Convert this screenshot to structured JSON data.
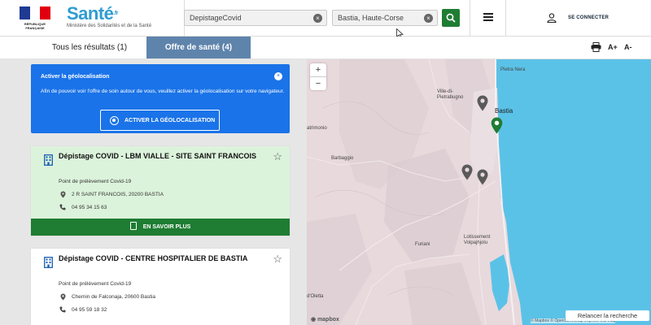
{
  "header": {
    "republic_text": "RÉPUBLIQUE FRANÇAISE",
    "brand_name": "Santé",
    "brand_suffix": ".fr",
    "brand_subtitle": "Ministère des Solidarités et de la Santé",
    "search_value": "DepistageCovid",
    "location_value": "Bastia, Haute-Corse",
    "connect_label": "SE CONNECTER"
  },
  "tabs": [
    {
      "label": "Tous les résultats (1)",
      "active": false
    },
    {
      "label": "Offre de santé (4)",
      "active": true
    }
  ],
  "toolbar": {
    "font_up": "A+",
    "font_down": "A-"
  },
  "geoloc": {
    "title": "Activer la géolocalisation",
    "text": "Afin de pouvoir voir l'offre de soin autour de vous, veuillez activer la géolocalisation sur votre navigateur.",
    "button_label": "ACTIVER LA GÉOLOCALISATION"
  },
  "results": [
    {
      "title": "Dépistage COVID - LBM VIALLE - SITE SAINT FRANCOIS",
      "type": "Point de prélèvement Covid-19",
      "address": "2 R SAINT FRANCOIS, 20200 BASTIA",
      "phone": "04 95 34 15 63",
      "more_label": "EN SAVOIR PLUS"
    },
    {
      "title": "Dépistage COVID - CENTRE HOSPITALIER DE BASTIA",
      "type": "Point de prélèvement Covid-19",
      "address": "Chemin de Falconaja, 20600 Bastia",
      "phone": "04 95 59 18 32"
    }
  ],
  "map": {
    "zoom_in": "+",
    "zoom_out": "−",
    "labels": {
      "pietra_nera": "Pietra Nera",
      "ville": "Ville-di-\nPietrabugno",
      "bastia": "Bastia",
      "patrimonio": "atrimonio",
      "barbaggio": "Barbaggio",
      "furiani": "Furiani",
      "lotissement": "Lotissement\nVolpajhjolu",
      "oletta": "d'Oletta"
    },
    "mapbox": "mapbox",
    "attribution": "© Mapbox © OpenStreetMap  Improve this map",
    "relaunch_label": "Relancer la recherche",
    "colors": {
      "sea": "#5bc2e7",
      "land": "#e8d9dd",
      "active_pin": "#1e7d32",
      "pin": "#555555"
    }
  },
  "colors": {
    "brand": "#2e9cd0",
    "tab_active": "#5f84ac",
    "geo_banner": "#1a73e8",
    "green": "#1e7d32",
    "card_highlight": "#dcf3db"
  }
}
